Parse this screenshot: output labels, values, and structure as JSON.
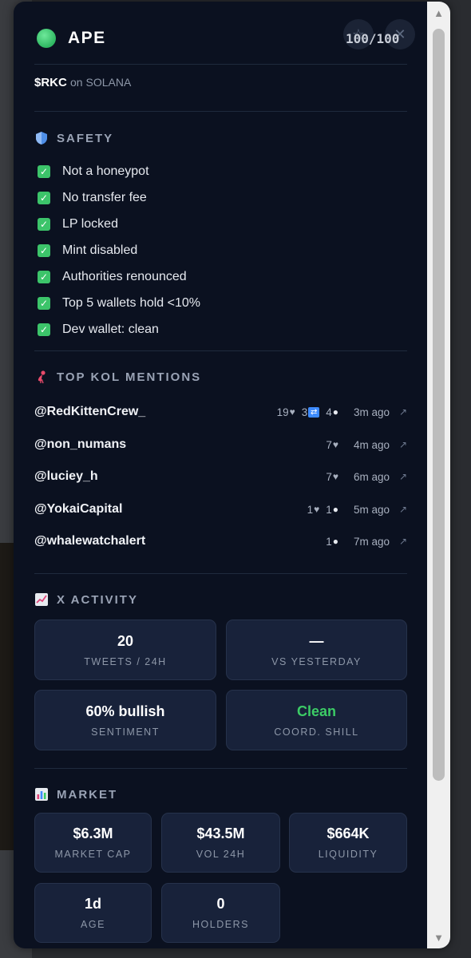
{
  "header": {
    "verdict": "APE",
    "score": "100/100",
    "star_icon": "star-icon",
    "close_icon": "close-icon"
  },
  "token": {
    "symbol": "$RKC",
    "chain": "on SOLANA"
  },
  "safety": {
    "title": "SAFETY",
    "icon": "shield-icon",
    "checks": [
      "Not a honeypot",
      "No transfer fee",
      "LP locked",
      "Mint disabled",
      "Authorities renounced",
      "Top 5 wallets hold <10%",
      "Dev wallet: clean"
    ]
  },
  "kol": {
    "title": "TOP KOL MENTIONS",
    "icon": "flamingo-icon",
    "mentions": [
      {
        "handle": "@RedKittenCrew_",
        "likes": "19",
        "retweets": "3",
        "replies": "4",
        "time": "3m ago"
      },
      {
        "handle": "@non_numans",
        "likes": "7",
        "retweets": "",
        "replies": "",
        "time": "4m ago"
      },
      {
        "handle": "@luciey_h",
        "likes": "7",
        "retweets": "",
        "replies": "",
        "time": "6m ago"
      },
      {
        "handle": "@YokaiCapital",
        "likes": "1",
        "retweets": "",
        "replies": "1",
        "time": "5m ago"
      },
      {
        "handle": "@whalewatchalert",
        "likes": "",
        "retweets": "",
        "replies": "1",
        "time": "7m ago"
      }
    ]
  },
  "x_activity": {
    "title": "X ACTIVITY",
    "icon": "chart-up-icon",
    "cards": [
      {
        "value": "20",
        "label": "TWEETS / 24H"
      },
      {
        "value": "—",
        "label": "VS YESTERDAY"
      },
      {
        "value": "60% bullish",
        "label": "SENTIMENT"
      },
      {
        "value": "Clean",
        "label": "COORD. SHILL"
      }
    ]
  },
  "market": {
    "title": "MARKET",
    "icon": "bar-chart-icon",
    "cards": [
      {
        "value": "$6.3M",
        "label": "MARKET CAP"
      },
      {
        "value": "$43.5M",
        "label": "VOL 24H"
      },
      {
        "value": "$664K",
        "label": "LIQUIDITY"
      },
      {
        "value": "1d",
        "label": "AGE"
      },
      {
        "value": "0",
        "label": "HOLDERS"
      }
    ]
  },
  "colors": {
    "panel_bg": "#0b1120",
    "card_bg": "#18223a",
    "check_green": "#3cc46a",
    "clean_green": "#3ccc66"
  }
}
